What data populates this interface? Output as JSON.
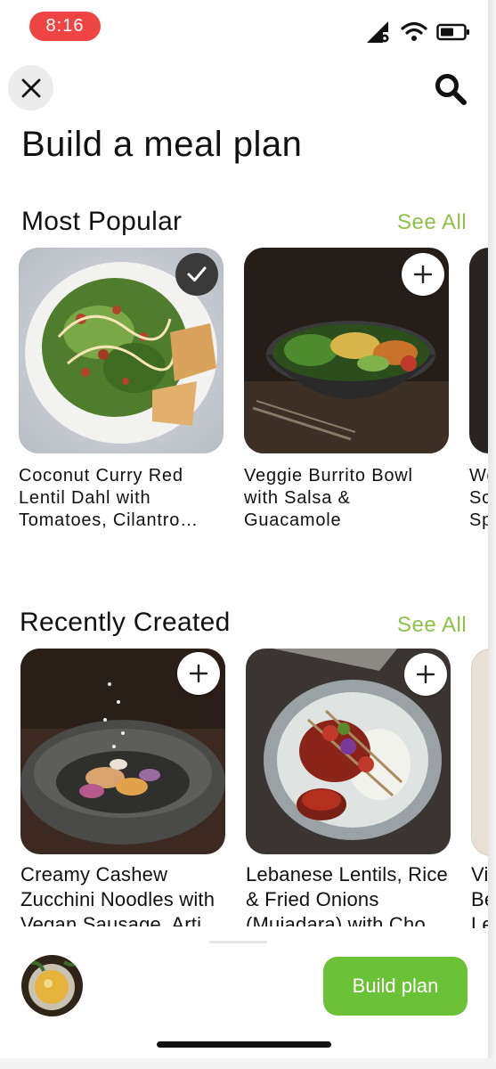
{
  "status_bar": {
    "time": "8:16"
  },
  "header": {
    "title": "Build a meal plan"
  },
  "most_popular": {
    "title": "Most Popular",
    "see_all": "See All",
    "items": [
      {
        "line1": "Coconut Curry Red",
        "line2": "Lentil Dahl with",
        "line3": "Tomatoes, Cilantro…",
        "selected": true
      },
      {
        "line1": "Veggie Burrito Bowl",
        "line2": "with Salsa &",
        "line3": "Guacamole",
        "selected": false
      },
      {
        "line1": "Wo",
        "line2": "So",
        "line3": "Sp"
      }
    ]
  },
  "recently_created": {
    "title": "Recently Created",
    "see_all": "See All",
    "items": [
      {
        "line1": "Creamy Cashew",
        "line2": "Zucchini Noodles with",
        "line3": "Vegan Sausage, Arti"
      },
      {
        "line1": "Lebanese Lentils, Rice",
        "line2": "& Fried Onions",
        "line3": "(Mujadara) with Cho"
      },
      {
        "line1": "Vi",
        "line2": "Be",
        "line3": "Le"
      }
    ]
  },
  "footer": {
    "build_label": "Build plan"
  },
  "colors": {
    "accent": "#6cc236",
    "see_all": "#8bc34a",
    "time_pill": "#ef4444"
  }
}
